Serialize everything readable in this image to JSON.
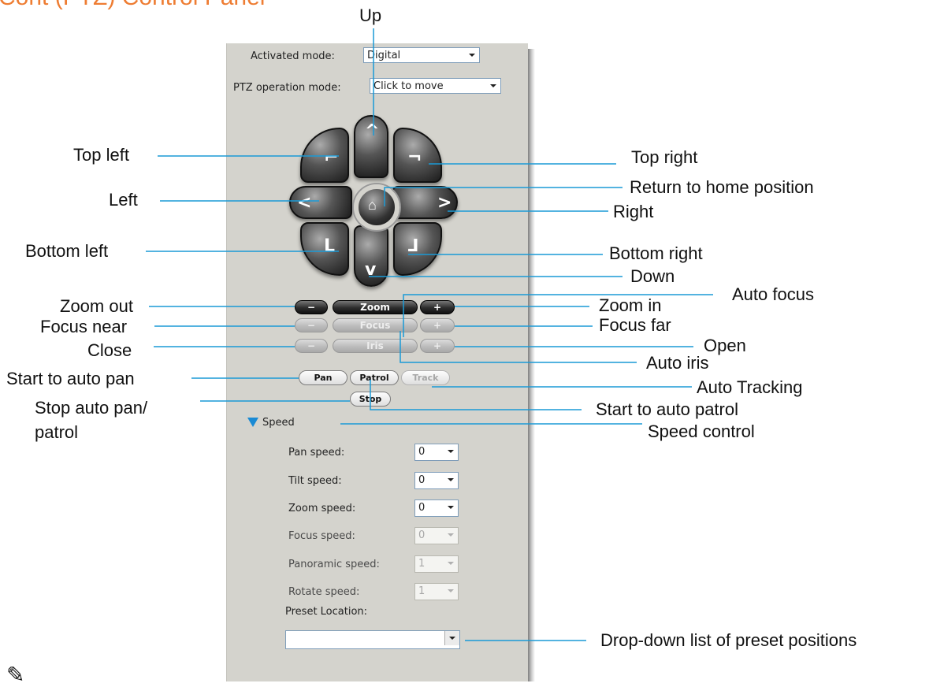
{
  "page": {
    "heading": "Cont (PTZ) Control Panel"
  },
  "panel": {
    "activated_mode_label": "Activated mode:",
    "activated_mode_value": "Digital",
    "ptz_mode_label": "PTZ operation mode:",
    "ptz_mode_value": "Click to move",
    "zoom_label": "Zoom",
    "focus_label": "Focus",
    "iris_label": "Iris",
    "minus": "−",
    "plus": "+",
    "pan_button": "Pan",
    "patrol_button": "Patrol",
    "track_button": "Track",
    "stop_button": "Stop",
    "speed_section": "Speed",
    "speeds": [
      {
        "label": "Pan speed:",
        "value": "0",
        "enabled": true
      },
      {
        "label": "Tilt speed:",
        "value": "0",
        "enabled": true
      },
      {
        "label": "Zoom speed:",
        "value": "0",
        "enabled": true
      },
      {
        "label": "Focus speed:",
        "value": "0",
        "enabled": false
      },
      {
        "label": "Panoramic speed:",
        "value": "1",
        "enabled": false
      },
      {
        "label": "Rotate speed:",
        "value": "1",
        "enabled": false
      }
    ],
    "preset_label": "Preset Location:",
    "preset_value": ""
  },
  "annotations": {
    "up": "Up",
    "top_left": "Top left",
    "top_right": "Top right",
    "left": "Left",
    "home": "Return to home position",
    "right": "Right",
    "bottom_left": "Bottom left",
    "bottom_right": "Bottom right",
    "down": "Down",
    "auto_focus": "Auto focus",
    "zoom_out": "Zoom out",
    "zoom_in": "Zoom in",
    "focus_near": "Focus near",
    "focus_far": "Focus far",
    "close": "Close",
    "open": "Open",
    "auto_iris": "Auto iris",
    "start_auto_pan": "Start to auto pan",
    "auto_tracking": "Auto Tracking",
    "stop_line1": "Stop auto pan/",
    "stop_line2": "patrol",
    "start_auto_patrol": "Start to auto patrol",
    "speed_control": "Speed control",
    "preset_list": "Drop-down list of preset positions"
  },
  "colors": {
    "callout_line": "#1a9ad6",
    "panel_bg": "#d4d3cd",
    "heading": "#ee7d33"
  },
  "icons": {
    "home": "home-icon",
    "arrows": "arrow-icons",
    "collapse": "triangle-down-icon",
    "note": "note-icon"
  }
}
